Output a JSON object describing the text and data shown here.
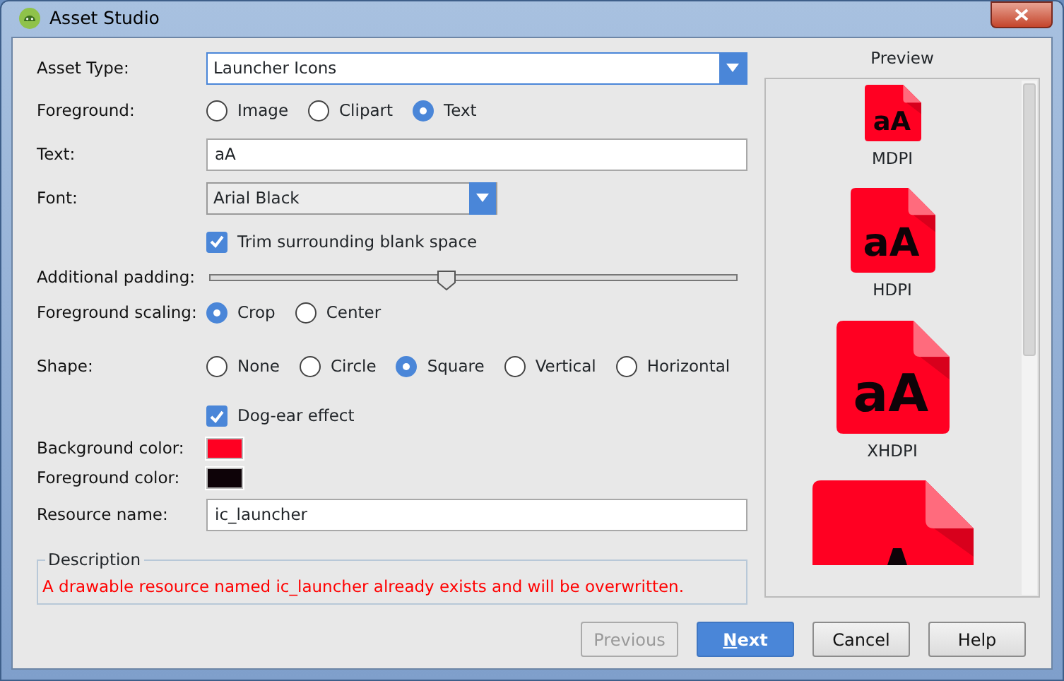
{
  "window": {
    "title": "Asset Studio"
  },
  "form": [
    {
      "kind": "dropdown",
      "label": "Asset Type:",
      "value": "Launcher Icons",
      "wide": true
    },
    {
      "kind": "radios",
      "label": "Foreground:",
      "options": [
        {
          "label": "Image",
          "selected": false
        },
        {
          "label": "Clipart",
          "selected": false
        },
        {
          "label": "Text",
          "selected": true
        }
      ]
    },
    {
      "kind": "text",
      "label": "Text:",
      "value": "aA"
    },
    {
      "kind": "dropdown",
      "label": "Font:",
      "value": "Arial Black",
      "wide": false
    },
    {
      "kind": "checkbox",
      "label": "Trim surrounding blank space",
      "checked": true
    },
    {
      "kind": "slider",
      "label": "Additional padding:",
      "level": 0.45
    },
    {
      "kind": "radios",
      "label": "Foreground scaling:",
      "options": [
        {
          "label": "Crop",
          "selected": true
        },
        {
          "label": "Center",
          "selected": false
        }
      ]
    },
    {
      "kind": "radios",
      "label": "Shape:",
      "options": [
        {
          "label": "None",
          "selected": false
        },
        {
          "label": "Circle",
          "selected": false
        },
        {
          "label": "Square",
          "selected": true
        },
        {
          "label": "Vertical",
          "selected": false
        },
        {
          "label": "Horizontal",
          "selected": false
        }
      ]
    },
    {
      "kind": "checkbox",
      "label": "Dog-ear effect",
      "checked": true
    },
    {
      "kind": "color",
      "label": "Background color:",
      "color": "#ff0022"
    },
    {
      "kind": "color",
      "label": "Foreground color:",
      "color": "#0e0308"
    },
    {
      "kind": "text",
      "label": "Resource name:",
      "value": "ic_launcher"
    }
  ],
  "description": {
    "title": "Description",
    "message": "A drawable resource named ic_launcher already exists and will be overwritten."
  },
  "preview": {
    "title": "Preview",
    "icons": [
      {
        "label": "MDPI",
        "text": "aA"
      },
      {
        "label": "HDPI",
        "text": "aA"
      },
      {
        "label": "XHDPI",
        "text": "aA"
      }
    ]
  },
  "buttons": [
    {
      "kind": "plain",
      "label": "Previous",
      "disabled": true
    },
    {
      "kind": "primary",
      "mnemonic": "N",
      "label_rest": "ext",
      "disabled": false
    },
    {
      "kind": "plain",
      "label": "Cancel",
      "disabled": false
    },
    {
      "kind": "plain",
      "label": "Help",
      "disabled": false
    }
  ]
}
